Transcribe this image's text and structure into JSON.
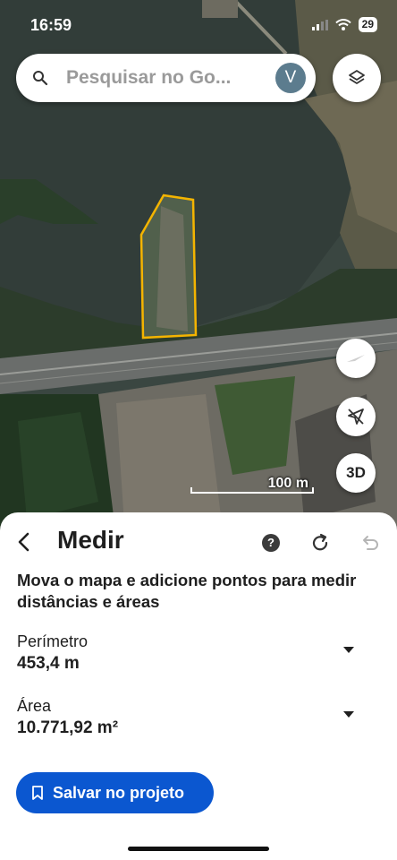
{
  "status_bar": {
    "time": "16:59",
    "battery": "29"
  },
  "search": {
    "placeholder": "Pesquisar no Go...",
    "avatar_letter": "V"
  },
  "map": {
    "scale_label": "100 m",
    "compass_button": "3D"
  },
  "sheet": {
    "title": "Medir",
    "help_symbol": "?",
    "instructions": "Mova o mapa e adicione pontos para medir distâncias e áreas",
    "perimeter": {
      "label": "Perímetro",
      "value": "453,4 m"
    },
    "area": {
      "label": "Área",
      "value": "10.771,92 m²"
    },
    "save_label": "Salvar no projeto"
  },
  "colors": {
    "accent": "#0b57d0",
    "polygon_outline": "#f4b400"
  },
  "icons": [
    "search-icon",
    "layers-icon",
    "compass-icon",
    "location-off-icon",
    "back-arrow-icon",
    "help-icon",
    "reset-icon",
    "undo-icon",
    "dropdown-arrow-icon",
    "bookmark-icon",
    "wifi-icon",
    "signal-icon"
  ]
}
